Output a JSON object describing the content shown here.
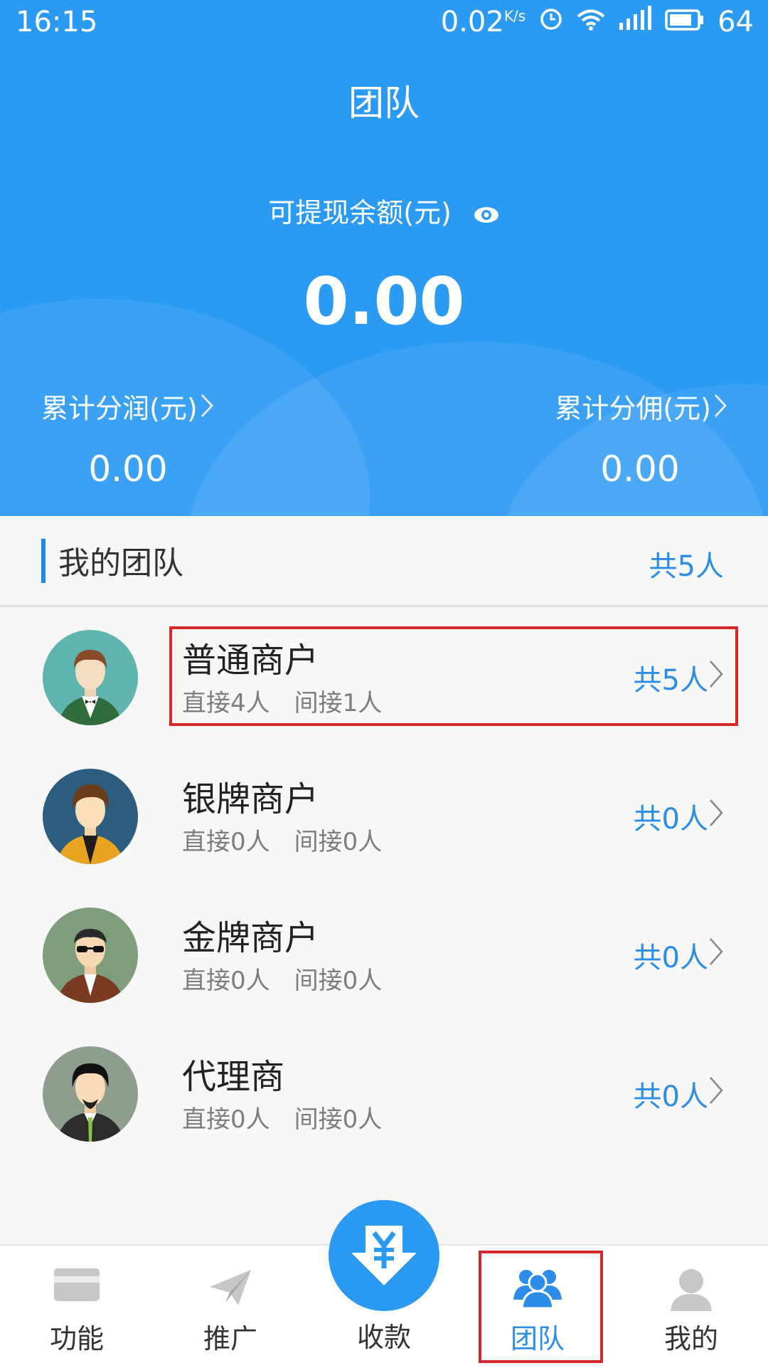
{
  "status_bar": {
    "time": "16:15",
    "speed": "0.02",
    "speed_unit": "K/s",
    "battery": "64",
    "icons": [
      "alarm-icon",
      "wifi-icon",
      "4g-signal-icon",
      "battery-icon"
    ]
  },
  "header": {
    "title": "团队",
    "balance_label": "可提现余额(元)",
    "balance_value": "0.00",
    "left_label": "累计分润(元)",
    "left_value": "0.00",
    "right_label": "累计分佣(元)",
    "right_value": "0.00",
    "accent_color": "#2b9af3"
  },
  "section": {
    "title": "我的团队",
    "count": "共5人"
  },
  "team_items": [
    {
      "name": "普通商户",
      "direct": "直接4人",
      "indirect": "间接1人",
      "count": "共5人",
      "avatar": "green-suit-avatar-icon"
    },
    {
      "name": "银牌商户",
      "direct": "直接0人",
      "indirect": "间接0人",
      "count": "共0人",
      "avatar": "orange-jacket-avatar-icon"
    },
    {
      "name": "金牌商户",
      "direct": "直接0人",
      "indirect": "间接0人",
      "count": "共0人",
      "avatar": "sunglasses-avatar-icon"
    },
    {
      "name": "代理商",
      "direct": "直接0人",
      "indirect": "间接0人",
      "count": "共0人",
      "avatar": "black-suit-avatar-icon"
    }
  ],
  "bottom_nav": {
    "items": [
      {
        "label": "功能",
        "icon": "card-icon"
      },
      {
        "label": "推广",
        "icon": "paper-plane-icon"
      },
      {
        "label": "收款",
        "icon": "yuan-download-icon"
      },
      {
        "label": "团队",
        "icon": "team-icon",
        "active": true
      },
      {
        "label": "我的",
        "icon": "user-icon"
      }
    ]
  }
}
